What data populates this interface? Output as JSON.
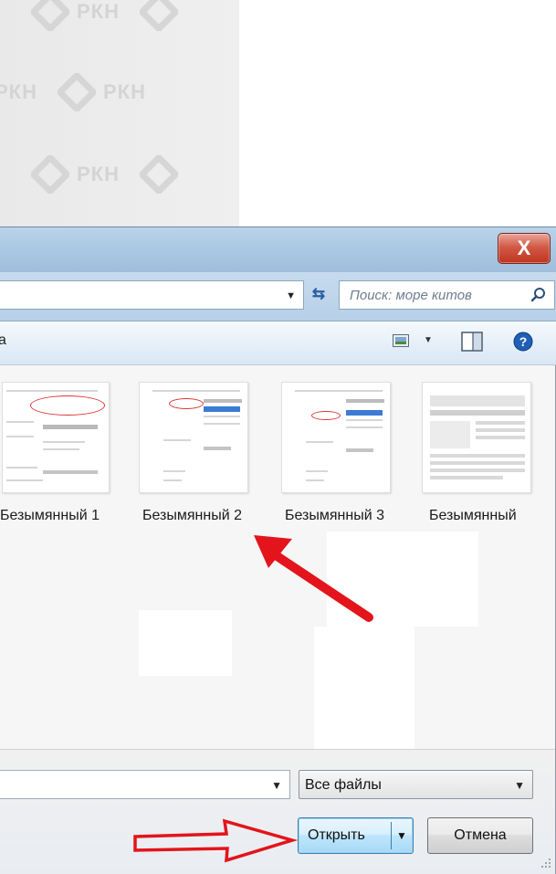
{
  "watermark": {
    "text": "РКН"
  },
  "dialog": {
    "close_glyph": "X"
  },
  "addressbar": {
    "dropdown_glyph": "▼",
    "refresh_glyph": "⇆"
  },
  "search": {
    "placeholder": "Поиск: море китов"
  },
  "toolbar": {
    "leading_text": "а",
    "dropdown_glyph": "▼"
  },
  "files": [
    {
      "name": "Безымянный 1"
    },
    {
      "name": "Безымянный 2"
    },
    {
      "name": "Безымянный 3"
    },
    {
      "name": "Безымянный"
    }
  ],
  "bottom": {
    "filename_value": "",
    "filename_dropdown_glyph": "▼",
    "filetype_selected": "Все файлы",
    "filetype_arrow": "▼",
    "open_label": "Открыть",
    "open_arrow": "▼",
    "cancel_label": "Отмена"
  },
  "colors": {
    "annotation_red": "#e3141b",
    "close_red": "#c93a25",
    "accent_blue": "#2a6ebd"
  }
}
